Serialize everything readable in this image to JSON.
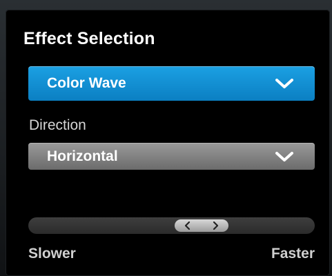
{
  "panel": {
    "title": "Effect Selection"
  },
  "effect_dropdown": {
    "selected": "Color Wave",
    "icon": "chevron-down-icon",
    "color": "#1290d2"
  },
  "direction": {
    "label": "Direction",
    "dropdown": {
      "selected": "Horizontal",
      "icon": "chevron-down-icon"
    }
  },
  "speed_slider": {
    "value_fraction": 0.63,
    "min_label": "Slower",
    "max_label": "Faster",
    "thumb_icons": [
      "chevron-left-icon",
      "chevron-right-icon"
    ]
  }
}
